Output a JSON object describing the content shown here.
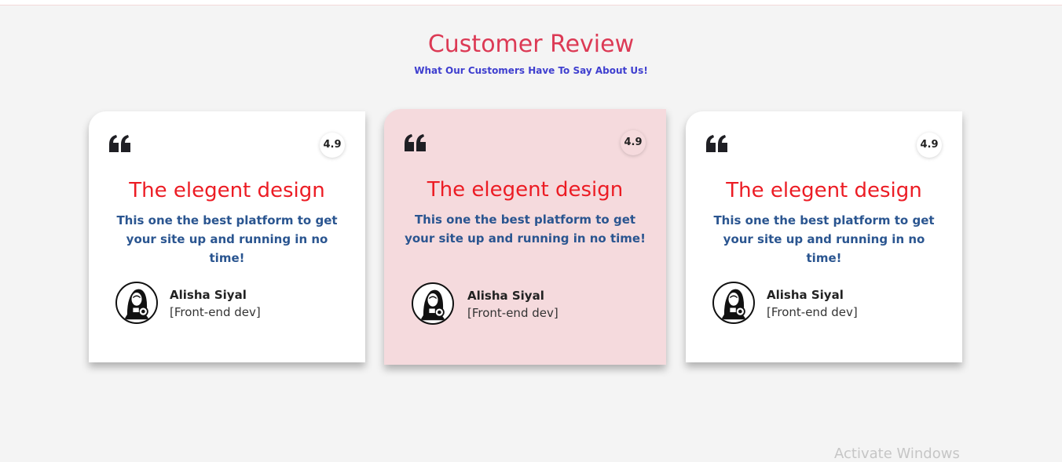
{
  "header": {
    "title": "Customer Review",
    "subtitle": "What Our Customers Have To Say About Us!"
  },
  "colors": {
    "title": "#dc3a55",
    "subtitle": "#3f3fcf",
    "card_title": "#ec1c24",
    "card_text": "#2a5590",
    "highlight_card_bg": "#f5dadd"
  },
  "cards": [
    {
      "rating": "4.9",
      "title": "The elegent design",
      "text": "This one the best platform to get your site up and running in no time!",
      "author_name": "Alisha Siyal",
      "author_role": "[Front-end dev]",
      "quote_icon": "quote-icon",
      "avatar_icon": "avatar-photographer-icon"
    },
    {
      "rating": "4.9",
      "title": "The elegent design",
      "text": "This one the best platform to get your site up and running in no time!",
      "author_name": "Alisha Siyal",
      "author_role": "[Front-end dev]",
      "quote_icon": "quote-icon",
      "avatar_icon": "avatar-photographer-icon"
    },
    {
      "rating": "4.9",
      "title": "The elegent design",
      "text": "This one the best platform to get your site up and running in no time!",
      "author_name": "Alisha Siyal",
      "author_role": "[Front-end dev]",
      "quote_icon": "quote-icon",
      "avatar_icon": "avatar-photographer-icon"
    }
  ],
  "watermark": "Activate Windows"
}
